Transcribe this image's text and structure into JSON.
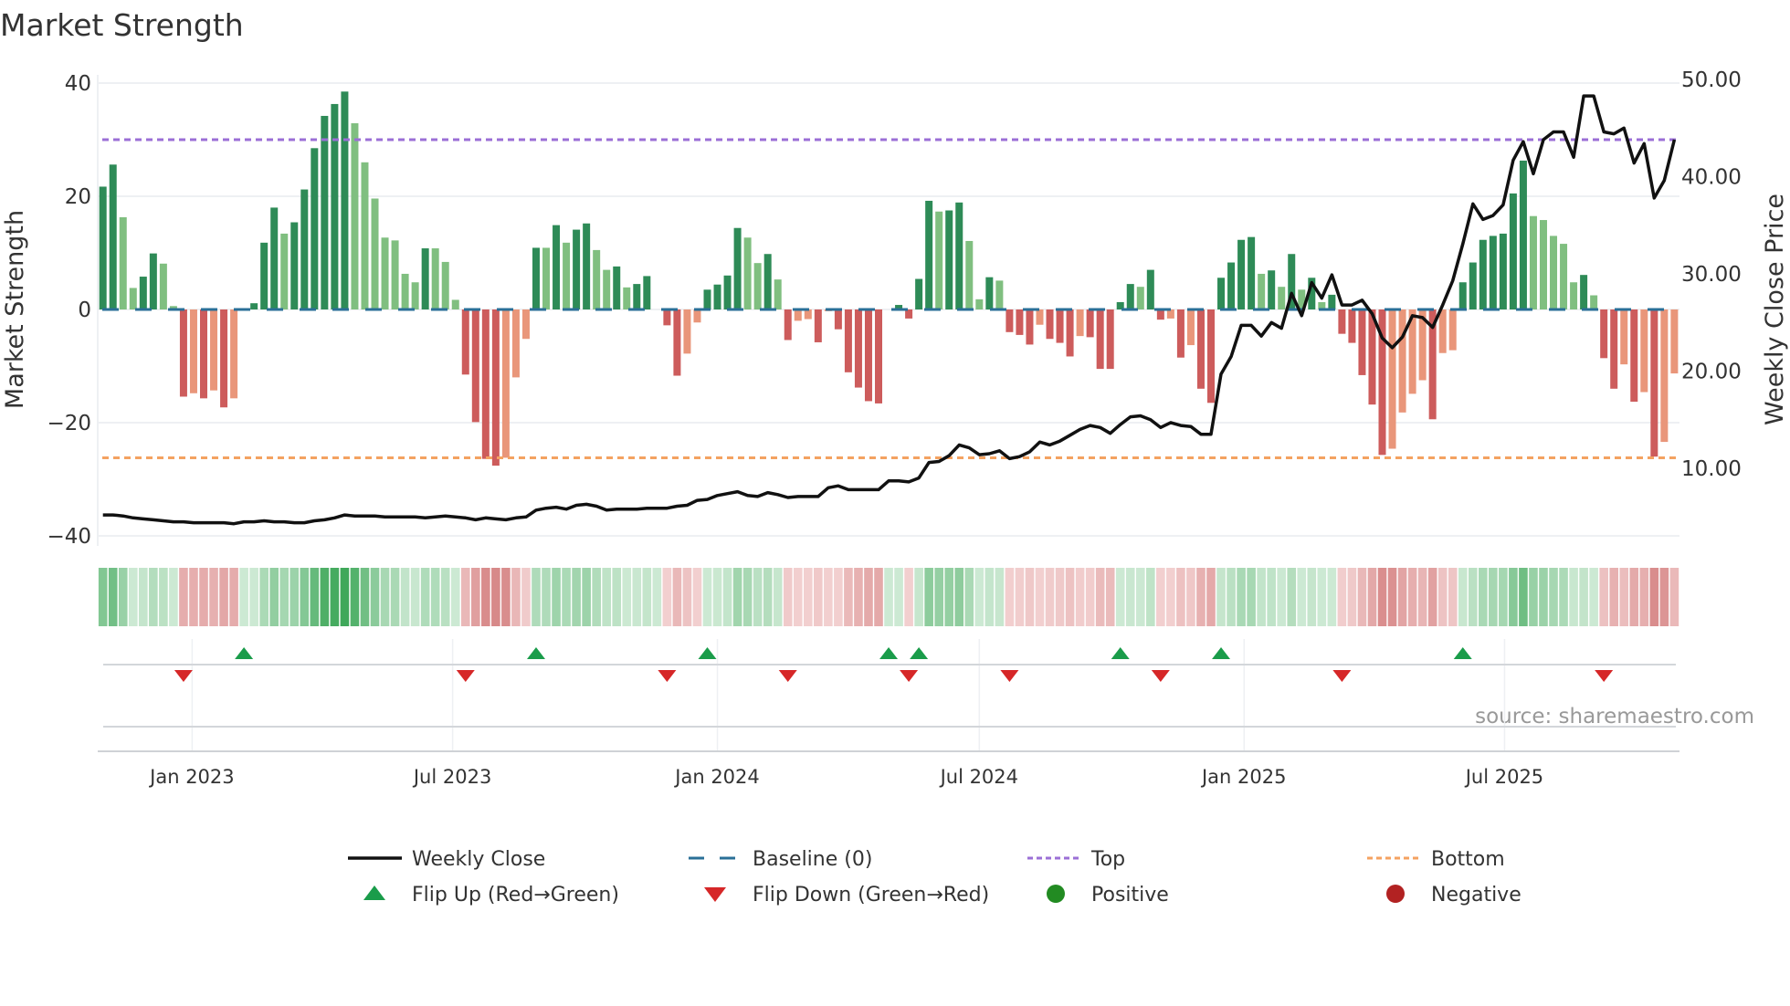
{
  "chart_data": {
    "type": "bar",
    "title": "Market Strength",
    "ylabel_left": "Market Strength",
    "ylabel_right": "Weekly Close Price",
    "ylim_left": [
      -40,
      40
    ],
    "ylim_right_ticks": [
      10,
      20,
      30,
      40,
      50
    ],
    "left_ticks": [
      {
        "v": 40,
        "label": "40"
      },
      {
        "v": 20,
        "label": "20"
      },
      {
        "v": 0,
        "label": "0"
      },
      {
        "v": -20,
        "label": "−20"
      },
      {
        "v": -40,
        "label": "−40"
      }
    ],
    "right_ticks": [
      {
        "v": 50,
        "label": "50.00"
      },
      {
        "v": 40,
        "label": "40.00"
      },
      {
        "v": 30,
        "label": "30.00"
      },
      {
        "v": 20,
        "label": "20.00"
      },
      {
        "v": 10,
        "label": "10.00"
      }
    ],
    "x_start": "2022-10-31",
    "x_step_days": 7,
    "x_ticks": [
      {
        "date": "2023-01-01",
        "label": "Jan 2023"
      },
      {
        "date": "2023-07-01",
        "label": "Jul 2023"
      },
      {
        "date": "2024-01-01",
        "label": "Jan 2024"
      },
      {
        "date": "2024-07-01",
        "label": "Jul 2024"
      },
      {
        "date": "2025-01-01",
        "label": "Jan 2025"
      },
      {
        "date": "2025-07-01",
        "label": "Jul 2025"
      }
    ],
    "top_level": 30,
    "bottom_level": -26.2,
    "strength": [
      21.7,
      25.6,
      16.3,
      3.8,
      5.8,
      9.9,
      8.1,
      0.6,
      -15.4,
      -14.8,
      -15.7,
      -14.3,
      -17.3,
      -15.7,
      0,
      1.1,
      11.8,
      18.0,
      13.4,
      15.4,
      21.2,
      28.5,
      34.2,
      36.3,
      38.5,
      32.9,
      26.0,
      19.6,
      12.7,
      12.2,
      6.3,
      4.8,
      10.8,
      10.8,
      8.4,
      1.7,
      -11.5,
      -19.9,
      -26.4,
      -27.6,
      -26.2,
      -12.0,
      -5.2,
      10.9,
      10.9,
      14.9,
      11.8,
      14.1,
      15.2,
      10.5,
      7.0,
      7.6,
      3.9,
      4.5,
      5.9,
      0,
      -2.8,
      -11.7,
      -7.8,
      -2.3,
      3.5,
      4.4,
      6.0,
      14.4,
      12.7,
      8.2,
      9.8,
      5.3,
      -5.4,
      -2.0,
      -1.7,
      -5.8,
      -0.3,
      -3.5,
      -11.1,
      -13.8,
      -16.2,
      -16.6,
      0,
      0.8,
      -1.6,
      5.4,
      19.2,
      17.3,
      17.5,
      18.9,
      12.1,
      1.8,
      5.7,
      5.1,
      -4.0,
      -4.5,
      -6.2,
      -2.7,
      -5.2,
      -5.9,
      -8.3,
      -4.7,
      -4.9,
      -10.5,
      -10.5,
      1.3,
      4.5,
      4.0,
      7.0,
      -1.8,
      -1.6,
      -8.5,
      -6.3,
      -14.0,
      -16.5,
      5.6,
      8.3,
      12.3,
      12.8,
      6.3,
      6.9,
      4.0,
      9.8,
      3.5,
      5.6,
      1.3,
      2.6,
      -4.3,
      -5.9,
      -11.6,
      -16.8,
      -25.7,
      -24.6,
      -18.2,
      -14.9,
      -12.5,
      -19.4,
      -7.7,
      -7.2,
      4.8,
      8.3,
      12.3,
      13.0,
      13.4,
      20.5,
      26.3,
      16.5,
      15.8,
      13.0,
      11.6,
      4.8,
      6.1,
      2.5,
      -8.6,
      -14.0,
      -9.7,
      -16.3,
      -14.6,
      -26.0,
      -23.4,
      -11.3
    ],
    "tone": [
      "D",
      "D",
      "L",
      "L",
      "D",
      "D",
      "L",
      "L",
      "R",
      "S",
      "R",
      "S",
      "R",
      "S",
      "L",
      "D",
      "D",
      "D",
      "L",
      "D",
      "D",
      "D",
      "D",
      "D",
      "D",
      "L",
      "L",
      "L",
      "L",
      "L",
      "L",
      "L",
      "D",
      "L",
      "L",
      "L",
      "R",
      "R",
      "R",
      "R",
      "S",
      "S",
      "S",
      "D",
      "L",
      "D",
      "L",
      "D",
      "D",
      "L",
      "L",
      "D",
      "L",
      "D",
      "D",
      "L",
      "R",
      "R",
      "S",
      "S",
      "D",
      "D",
      "D",
      "D",
      "L",
      "L",
      "D",
      "L",
      "R",
      "S",
      "S",
      "R",
      "S",
      "R",
      "R",
      "R",
      "R",
      "R",
      "L",
      "D",
      "R",
      "D",
      "D",
      "L",
      "D",
      "D",
      "L",
      "L",
      "D",
      "L",
      "R",
      "R",
      "R",
      "S",
      "R",
      "R",
      "R",
      "S",
      "R",
      "R",
      "R",
      "D",
      "D",
      "L",
      "D",
      "R",
      "S",
      "R",
      "S",
      "R",
      "R",
      "D",
      "D",
      "D",
      "D",
      "L",
      "D",
      "L",
      "D",
      "L",
      "D",
      "L",
      "D",
      "R",
      "R",
      "R",
      "R",
      "R",
      "S",
      "S",
      "S",
      "S",
      "R",
      "S",
      "S",
      "D",
      "D",
      "D",
      "D",
      "D",
      "D",
      "D",
      "L",
      "L",
      "L",
      "L",
      "L",
      "D",
      "L",
      "R",
      "R",
      "S",
      "R",
      "S",
      "R",
      "S",
      "S"
    ],
    "weekly_close": [
      5.2,
      5.2,
      5.1,
      4.9,
      4.8,
      4.7,
      4.6,
      4.5,
      4.5,
      4.4,
      4.4,
      4.4,
      4.4,
      4.3,
      4.5,
      4.5,
      4.6,
      4.5,
      4.5,
      4.4,
      4.4,
      4.6,
      4.7,
      4.9,
      5.2,
      5.1,
      5.1,
      5.1,
      5.0,
      5.0,
      5.0,
      5.0,
      4.9,
      5.0,
      5.1,
      5.0,
      4.9,
      4.7,
      4.9,
      4.8,
      4.7,
      4.9,
      5.0,
      5.7,
      5.9,
      6.0,
      5.8,
      6.2,
      6.3,
      6.1,
      5.7,
      5.8,
      5.8,
      5.8,
      5.9,
      5.9,
      5.9,
      6.1,
      6.2,
      6.7,
      6.8,
      7.2,
      7.4,
      7.6,
      7.2,
      7.1,
      7.5,
      7.3,
      7.0,
      7.1,
      7.1,
      7.1,
      8.0,
      8.2,
      7.8,
      7.8,
      7.8,
      7.8,
      8.7,
      8.7,
      8.6,
      9.0,
      10.6,
      10.7,
      11.3,
      12.4,
      12.1,
      11.4,
      11.5,
      11.8,
      11.0,
      11.2,
      11.7,
      12.7,
      12.4,
      12.8,
      13.4,
      14.0,
      14.4,
      14.2,
      13.6,
      14.5,
      15.3,
      15.4,
      15.0,
      14.2,
      14.7,
      14.4,
      14.3,
      13.5,
      13.5,
      19.7,
      21.5,
      24.7,
      24.7,
      23.6,
      25.0,
      24.4,
      28.0,
      25.7,
      29.1,
      27.5,
      29.9,
      26.8,
      26.8,
      27.3,
      25.9,
      23.4,
      22.4,
      23.5,
      25.7,
      25.5,
      24.5,
      26.8,
      29.3,
      33.1,
      37.2,
      35.6,
      36.0,
      37.1,
      41.7,
      43.6,
      40.3,
      43.8,
      44.6,
      44.6,
      42.0,
      48.3,
      48.3,
      44.6,
      44.4,
      45.0,
      41.4,
      43.4,
      37.8,
      39.6,
      43.8
    ],
    "flip_up_weeks": [
      15,
      44,
      61,
      79,
      82,
      102,
      112,
      136
    ],
    "flip_down_weeks": [
      9,
      37,
      57,
      69,
      81,
      91,
      106,
      124,
      150
    ],
    "legend": [
      {
        "key": "close",
        "label": "Weekly Close"
      },
      {
        "key": "baseline",
        "label": "Baseline (0)"
      },
      {
        "key": "top",
        "label": "Top"
      },
      {
        "key": "bottom",
        "label": "Bottom"
      },
      {
        "key": "flip_up",
        "label": "Flip Up (Red→Green)"
      },
      {
        "key": "flip_down",
        "label": "Flip Down (Green→Red)"
      },
      {
        "key": "positive",
        "label": "Positive"
      },
      {
        "key": "negative",
        "label": "Negative"
      }
    ],
    "legend_placement": "bottom",
    "grid": true,
    "source": "source: sharemaestro.com"
  },
  "colors": {
    "D": "#2e8b57",
    "L": "#80bf80",
    "R": "#cd5c5c",
    "S": "#e9967a",
    "baseline": "#2a6f97",
    "top": "#9b6fd6",
    "bottom": "#f4a261",
    "close": "#111111",
    "flip_up": "#1a9c4a",
    "flip_down": "#d62728",
    "positive": "#228b22",
    "negative": "#b22222"
  }
}
